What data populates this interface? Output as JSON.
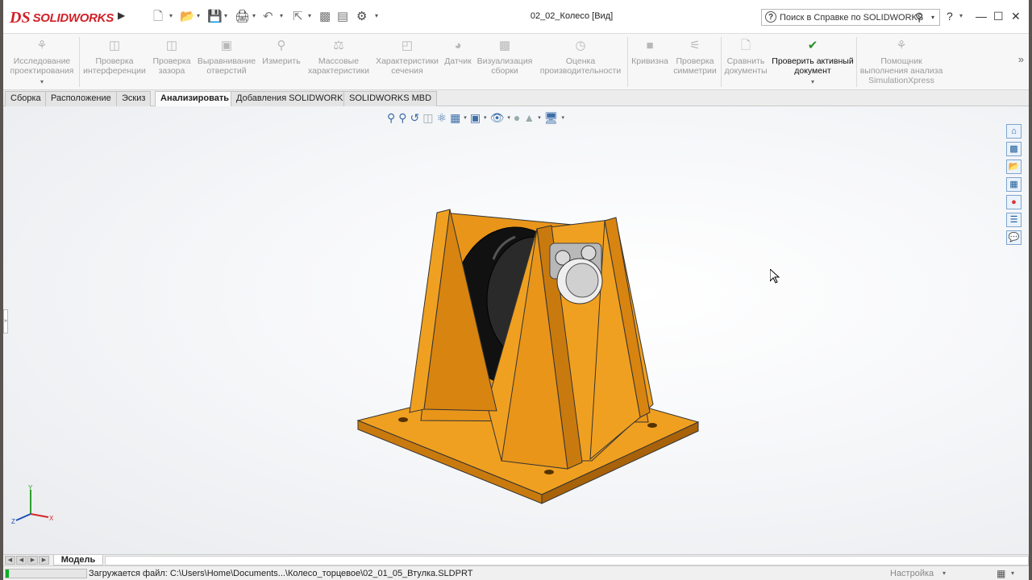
{
  "app": {
    "brand_ds": "DS",
    "brand_name": "SOLIDWORKS",
    "document_title": "02_02_Колесо [Вид]"
  },
  "quick_access": [
    {
      "icon": "new-document-icon"
    },
    {
      "icon": "open-folder-icon"
    },
    {
      "icon": "save-icon"
    },
    {
      "icon": "print-icon"
    },
    {
      "icon": "undo-icon"
    },
    {
      "icon": "select-pointer-icon"
    },
    {
      "icon": "rebuild-icon"
    },
    {
      "icon": "file-properties-icon"
    },
    {
      "icon": "options-gear-icon"
    }
  ],
  "help_search": {
    "placeholder": "Поиск в Справке по SOLIDWORKS"
  },
  "title_controls": {
    "help": "?",
    "minimize": "—",
    "maximize": "☐",
    "close": "✕"
  },
  "ribbon": {
    "design_study": "Исследование проектирования",
    "interference": "Проверка интерференции",
    "clearance": "Проверка зазора",
    "hole_alignment": "Выравнивание отверстий",
    "measure": "Измерить",
    "mass_props": "Массовые характеристики",
    "section_props": "Характеристики сечения",
    "sensor": "Датчик",
    "assembly_vis": "Визуализация сборки",
    "performance": "Оценка производительности",
    "curvature": "Кривизна",
    "symmetry": "Проверка симметрии",
    "compare": "Сравнить документы",
    "check_active": "Проверить активный документ",
    "simxpress": "Помощник выполнения анализа SimulationXpress"
  },
  "tabs": [
    "Сборка",
    "Расположение",
    "Эскиз",
    "Анализировать",
    "Добавления SOLIDWORKS",
    "SOLIDWORKS MBD"
  ],
  "active_tab": "Анализировать",
  "model_tab": "Модель",
  "triad": {
    "x": "X",
    "y": "Y",
    "z": "Z"
  },
  "status": {
    "loading_text": "Загружается файл: C:\\Users\\Home\\Documents...\\Колесо_торцевое\\02_01_05_Втулка.SLDPRT",
    "settings": "Настройка",
    "progress_fraction": 0.04
  },
  "colors": {
    "bracket_orange": "#f0a020",
    "wheel_black": "#1a1a1a",
    "brand_red": "#d32027",
    "progress_green": "#06b025"
  }
}
